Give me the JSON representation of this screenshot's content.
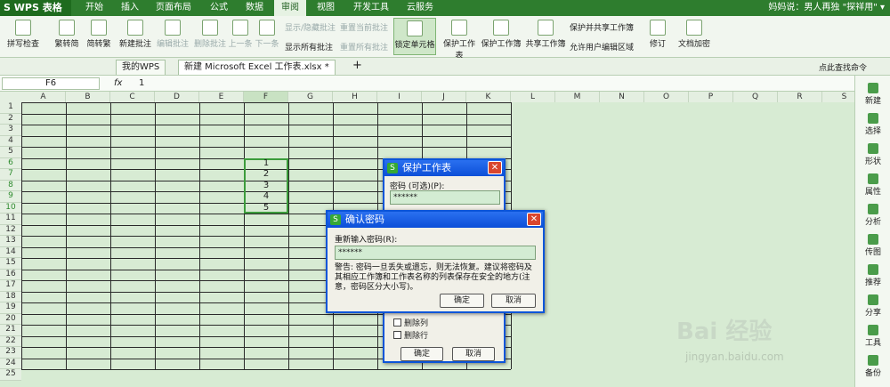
{
  "app": {
    "logo": "S WPS 表格"
  },
  "tabs": [
    "开始",
    "插入",
    "页面布局",
    "公式",
    "数据",
    "审阅",
    "视图",
    "开发工具",
    "云服务"
  ],
  "active_tab": "审阅",
  "title_right": "妈妈说：男人再独 \"探祥用\" ▾",
  "ribbon": {
    "spell": "拼写检查",
    "fan2jian": "繁转简",
    "jian2fan": "简转繁",
    "new_comment": "新建批注",
    "edit_comment": "编辑批注",
    "delete_comment": "删除批注",
    "prev": "上一条",
    "next": "下一条",
    "show_hide_comment": "显示/隐藏批注",
    "reset_comment": "重置当前批注",
    "show_all": "显示所有批注",
    "reset_all": "重置所有批注",
    "lock_cell": "锁定单元格",
    "protect_sheet": "保护工作表",
    "protect_book": "保护工作簿",
    "share_book": "共享工作簿",
    "protect_share": "保护并共享工作簿",
    "allow_edit": "允许用户编辑区域",
    "revise": "修订",
    "doc_encrypt": "文档加密"
  },
  "doc_tabs": [
    "我的WPS",
    "新建 Microsoft Excel 工作表.xlsx *"
  ],
  "search_cmd": "点此查找命令",
  "name_box": "F6",
  "fx": "fx",
  "formula_value": "1",
  "columns": [
    "A",
    "B",
    "C",
    "D",
    "E",
    "F",
    "G",
    "H",
    "I",
    "J",
    "K",
    "L",
    "M",
    "N",
    "O",
    "P",
    "Q",
    "R",
    "S"
  ],
  "rows": [
    "1",
    "2",
    "3",
    "4",
    "5",
    "6",
    "7",
    "8",
    "9",
    "10",
    "11",
    "12",
    "13",
    "14",
    "15",
    "16",
    "17",
    "18",
    "19",
    "20",
    "21",
    "22",
    "23",
    "24",
    "25"
  ],
  "cells_F": [
    "1",
    "2",
    "3",
    "4",
    "5"
  ],
  "side_panel": [
    "新建",
    "选择",
    "形状",
    "属性",
    "分析",
    "传图",
    "推荐",
    "分享",
    "工具",
    "备份"
  ],
  "protect_dialog": {
    "title": "保护工作表",
    "pwd_label": "密码 (可选)(P):",
    "pwd_value": "******",
    "opts": [
      "删除列",
      "删除行"
    ],
    "ok": "确定",
    "cancel": "取消"
  },
  "confirm_dialog": {
    "title": "确认密码",
    "label": "重新输入密码(R):",
    "value": "******",
    "warning": "警告: 密码一旦丢失或遗忘，则无法恢复。建议将密码及其相应工作簿和工作表名称的列表保存在安全的地方(注意，密码区分大小写)。",
    "ok": "确定",
    "cancel": "取消"
  },
  "watermark": "Bai 经验",
  "watermark_url": "jingyan.baidu.com"
}
